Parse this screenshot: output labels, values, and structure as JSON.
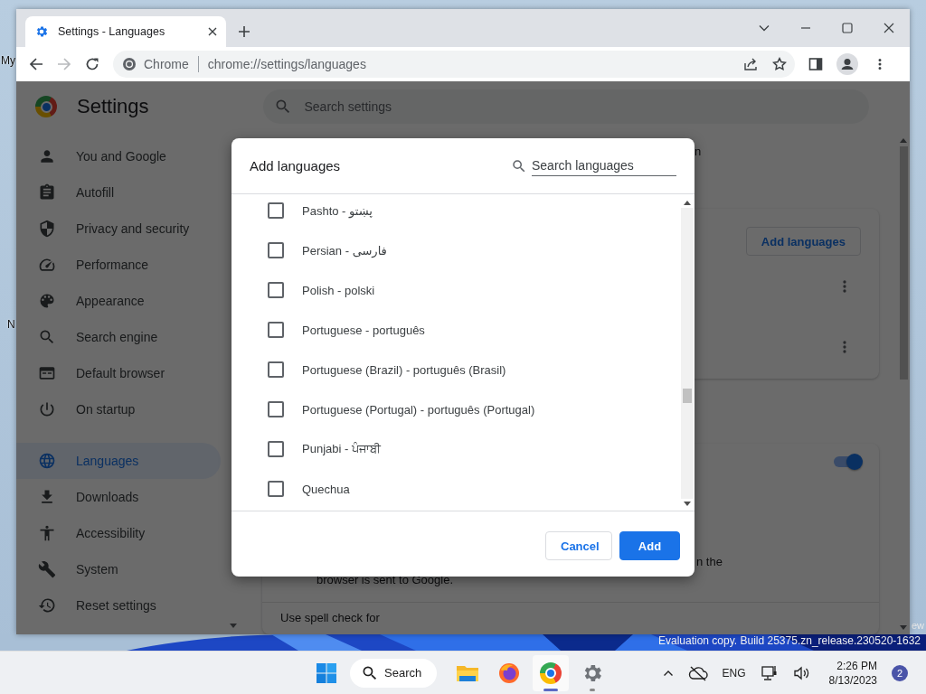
{
  "desktop": {
    "icon_labels": [
      "My",
      "N"
    ],
    "watermark": "Evaluation copy. Build 25375.zn_release.230520-1632",
    "edge_text": "ew"
  },
  "browser": {
    "tabs": [
      {
        "title": "Settings - Languages",
        "selected": true
      }
    ],
    "omnibox": {
      "chip": "Chrome",
      "url": "chrome://settings/languages"
    },
    "forward_disabled": true
  },
  "settings": {
    "title": "Settings",
    "search_placeholder": "Search settings",
    "sidebar": [
      {
        "label": "You and Google",
        "selected": false
      },
      {
        "label": "Autofill",
        "selected": false
      },
      {
        "label": "Privacy and security",
        "selected": false
      },
      {
        "label": "Performance",
        "selected": false
      },
      {
        "label": "Appearance",
        "selected": false
      },
      {
        "label": "Search engine",
        "selected": false
      },
      {
        "label": "Default browser",
        "selected": false
      },
      {
        "label": "On startup",
        "selected": false
      },
      {
        "label": "Languages",
        "selected": true
      },
      {
        "label": "Downloads",
        "selected": false
      },
      {
        "label": "Accessibility",
        "selected": false
      },
      {
        "label": "System",
        "selected": false
      },
      {
        "label": "Reset settings",
        "selected": false
      }
    ],
    "main": {
      "top_text": "n",
      "languages_card": {
        "button": "Add languages"
      },
      "spell_card": {
        "toggle": {
          "on": true
        },
        "text_right": "n the",
        "text_left": "browser is sent to Google.",
        "spell_check_label": "Use spell check for"
      }
    }
  },
  "dialog": {
    "title": "Add languages",
    "search_placeholder": "Search languages",
    "languages": [
      {
        "label": "Pashto - پښتو",
        "checked": false
      },
      {
        "label": "Persian - فارسی",
        "checked": false
      },
      {
        "label": "Polish - polski",
        "checked": false
      },
      {
        "label": "Portuguese - português",
        "checked": false
      },
      {
        "label": "Portuguese (Brazil) - português (Brasil)",
        "checked": false
      },
      {
        "label": "Portuguese (Portugal) - português (Portugal)",
        "checked": false
      },
      {
        "label": "Punjabi - ਪੰਜਾਬੀ",
        "checked": false
      },
      {
        "label": "Quechua",
        "checked": false
      }
    ],
    "buttons": [
      {
        "label": "Cancel",
        "kind": "secondary"
      },
      {
        "label": "Add",
        "kind": "primary"
      }
    ]
  },
  "taskbar": {
    "search": "Search",
    "apps": [
      {
        "kind": "explorer",
        "running": false,
        "selected": false
      },
      {
        "kind": "firefox",
        "running": false,
        "selected": false
      },
      {
        "kind": "chrome",
        "running": true,
        "selected": true
      },
      {
        "kind": "settings",
        "running": true,
        "selected": false
      }
    ],
    "language": "ENG",
    "time": "2:26 PM",
    "date": "8/13/2023",
    "notifications": "2"
  }
}
